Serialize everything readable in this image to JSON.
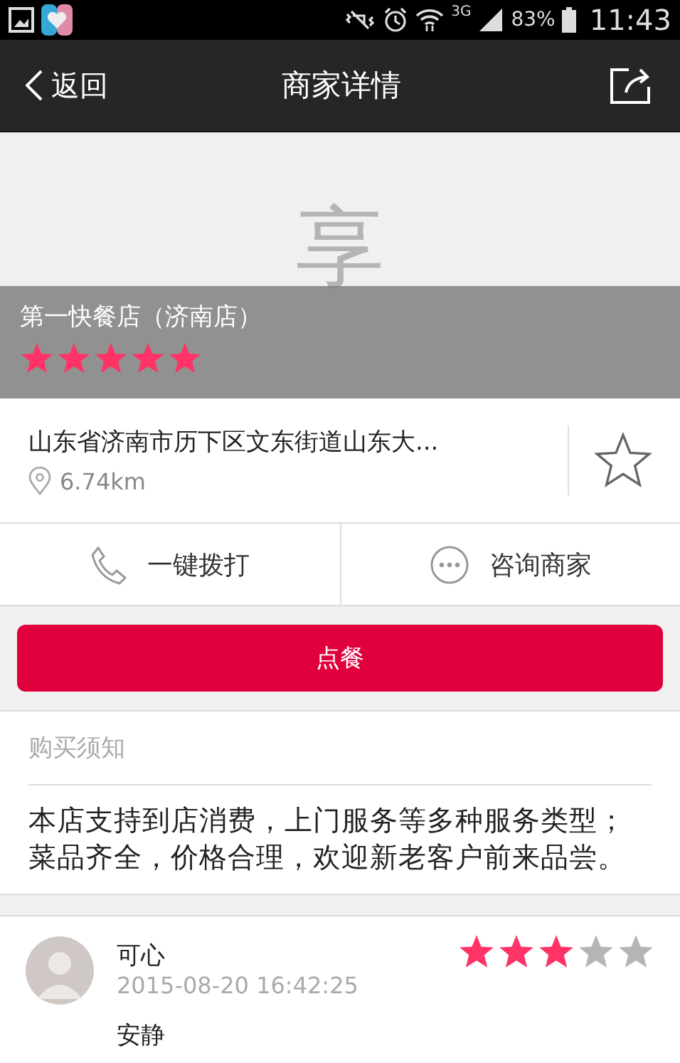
{
  "status_bar": {
    "network": "3G",
    "battery": "83%",
    "time": "11:43"
  },
  "nav": {
    "back": "返回",
    "title": "商家详情"
  },
  "banner": {
    "placeholder_logo": "享",
    "name": "第一快餐店（济南店）",
    "stars": 5
  },
  "address": {
    "text": "山东省济南市历下区文东街道山东大...",
    "distance": "6.74km",
    "favorite": false
  },
  "actions": [
    {
      "kind": "phone",
      "label": "一键拨打"
    },
    {
      "kind": "chat",
      "label": "咨询商家"
    }
  ],
  "order_button": "点餐",
  "notice": {
    "title": "购买须知",
    "text": "本店支持到店消费，上门服务等多种服务类型；菜品齐全，价格合理，欢迎新老客户前来品尝。"
  },
  "reviews": [
    {
      "user": "可心",
      "time": "2015-08-20 16:42:25",
      "stars": 3,
      "text": "安静"
    }
  ]
}
